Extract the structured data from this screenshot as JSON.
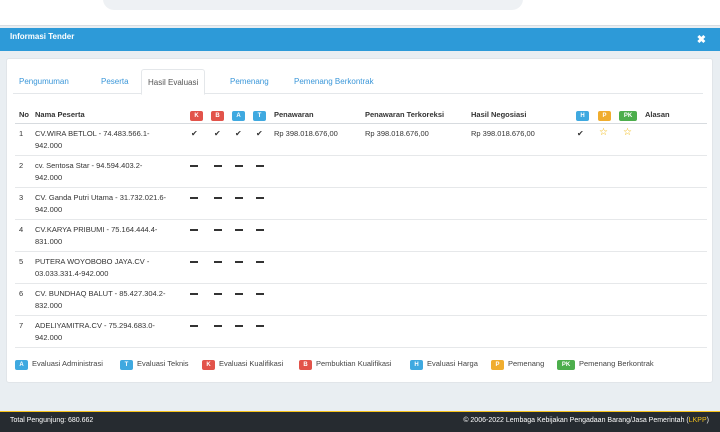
{
  "modal": {
    "title": "Informasi Tender",
    "close_icon": "times-icon"
  },
  "tabs": [
    {
      "label": "Pengumuman",
      "active": false
    },
    {
      "label": "Peserta",
      "active": false
    },
    {
      "label": "Hasil Evaluasi",
      "active": true
    },
    {
      "label": "Pemenang",
      "active": false
    },
    {
      "label": "Pemenang Berkontrak",
      "active": false
    }
  ],
  "table": {
    "headers": {
      "no": "No",
      "nama": "Nama Peserta",
      "k": "K",
      "b": "B",
      "a": "A",
      "t": "T",
      "penawaran": "Penawaran",
      "terkoreksi": "Penawaran Terkoreksi",
      "negosiasi": "Hasil Negosiasi",
      "h": "H",
      "p": "P",
      "pk": "PK",
      "alasan": "Alasan"
    },
    "rows": [
      {
        "no": "1",
        "nama_1": "CV.WIRA BETLOL - 74.483.566.1-",
        "nama_2": "942.000",
        "eval": "check",
        "penawaran": "Rp 398.018.676,00",
        "terkoreksi": "Rp 398.018.676,00",
        "negosiasi": "Rp 398.018.676,00",
        "winner": true
      },
      {
        "no": "2",
        "nama_1": "cv. Sentosa Star - 94.594.403.2-",
        "nama_2": "942.000",
        "eval": "dash"
      },
      {
        "no": "3",
        "nama_1": "CV. Ganda Putri Utama - 31.732.021.6-",
        "nama_2": "942.000",
        "eval": "dash"
      },
      {
        "no": "4",
        "nama_1": "CV.KARYA PRIBUMI - 75.164.444.4-",
        "nama_2": "831.000",
        "eval": "dash"
      },
      {
        "no": "5",
        "nama_1": "PUTERA WOYOBOBO JAYA.CV -",
        "nama_2": "03.033.331.4-942.000",
        "eval": "dash"
      },
      {
        "no": "6",
        "nama_1": "CV. BUNDHAQ BALUT - 85.427.304.2-",
        "nama_2": "832.000",
        "eval": "dash"
      },
      {
        "no": "7",
        "nama_1": "ADELIYAMITRA.CV - 75.294.683.0-",
        "nama_2": "942.000",
        "eval": "dash"
      }
    ]
  },
  "legend": [
    {
      "code": "A",
      "label": "Evaluasi Administrasi",
      "color": "#3fa9e0"
    },
    {
      "code": "T",
      "label": "Evaluasi Teknis",
      "color": "#3fa9e0"
    },
    {
      "code": "K",
      "label": "Evaluasi Kualifikasi",
      "color": "#e2534a"
    },
    {
      "code": "B",
      "label": "Pembuktian Kualifikasi",
      "color": "#e2534a"
    },
    {
      "code": "H",
      "label": "Evaluasi Harga",
      "color": "#3fa9e0"
    },
    {
      "code": "P",
      "label": "Pemenang",
      "color": "#f0ad2e"
    },
    {
      "code": "PK",
      "label": "Pemenang Berkontrak",
      "color": "#4cae4c"
    }
  ],
  "footer": {
    "visits": "Total Pengunjung: 680.662",
    "copyright": "© 2006-2022 Lembaga Kebijakan Pengadaan Barang/Jasa Pemerintah (",
    "lkpp": "LKPP",
    "close_paren": ")"
  }
}
